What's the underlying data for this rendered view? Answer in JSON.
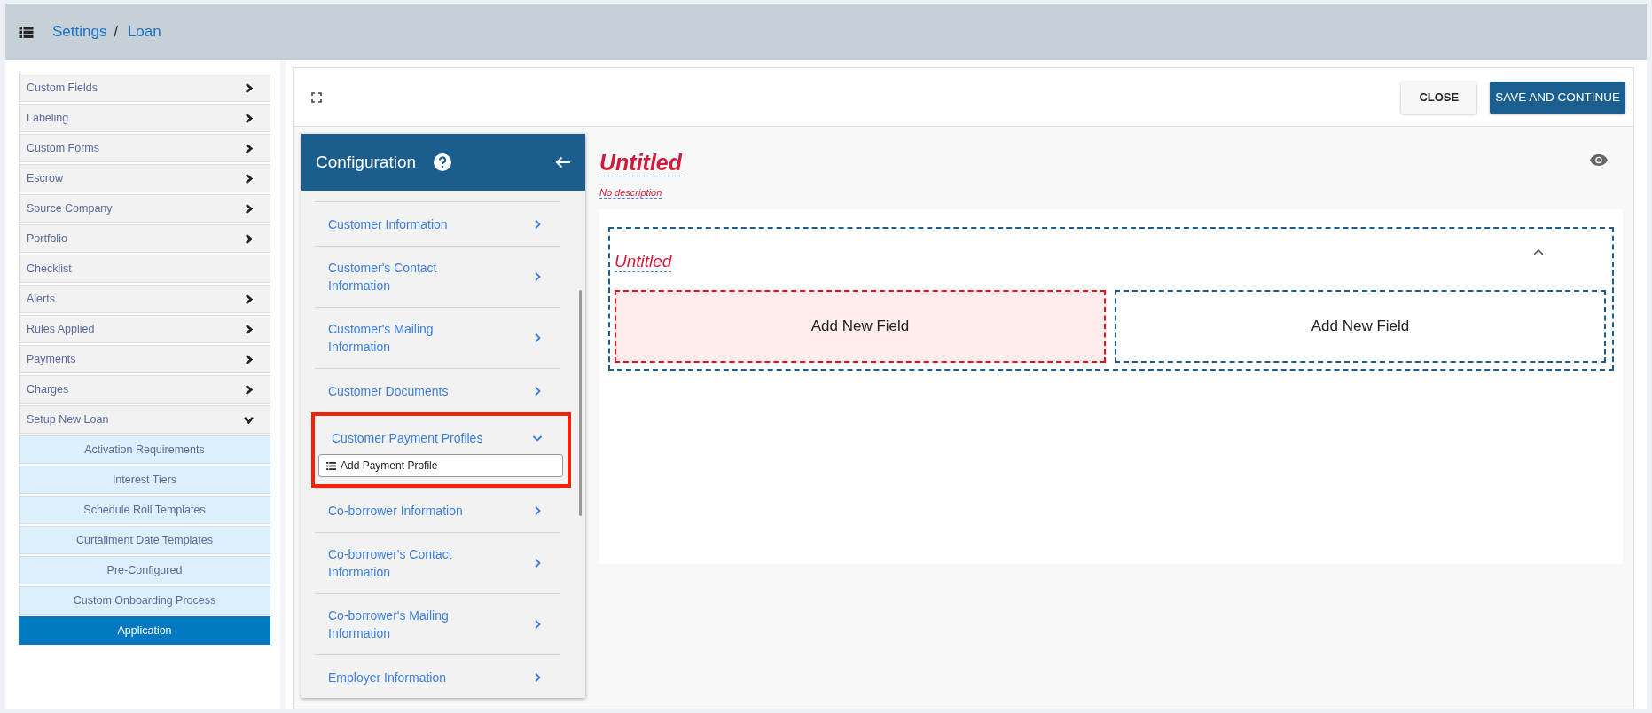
{
  "breadcrumb": [
    "Settings",
    "Loan"
  ],
  "breadcrumb_separator": "/",
  "sidebar": {
    "items": [
      {
        "label": "Custom Fields",
        "kind": "menu",
        "expanded": false
      },
      {
        "label": "Labeling",
        "kind": "menu",
        "expanded": false
      },
      {
        "label": "Custom Forms",
        "kind": "menu",
        "expanded": false
      },
      {
        "label": "Escrow",
        "kind": "menu",
        "expanded": false
      },
      {
        "label": "Source Company",
        "kind": "menu",
        "expanded": false
      },
      {
        "label": "Portfolio",
        "kind": "menu",
        "expanded": false
      },
      {
        "label": "Checklist",
        "kind": "plain"
      },
      {
        "label": "Alerts",
        "kind": "menu",
        "expanded": false
      },
      {
        "label": "Rules Applied",
        "kind": "menu",
        "expanded": false
      },
      {
        "label": "Payments",
        "kind": "menu",
        "expanded": false
      },
      {
        "label": "Charges",
        "kind": "menu",
        "expanded": false
      },
      {
        "label": "Setup New Loan",
        "kind": "menu",
        "expanded": true,
        "children": [
          {
            "label": "Activation Requirements",
            "selected": false
          },
          {
            "label": "Interest Tiers",
            "selected": false
          },
          {
            "label": "Schedule Roll Templates",
            "selected": false
          },
          {
            "label": "Curtailment Date Templates",
            "selected": false
          },
          {
            "label": "Pre-Configured",
            "selected": false
          },
          {
            "label": "Custom Onboarding Process",
            "selected": false
          },
          {
            "label": "Application",
            "selected": true
          }
        ]
      }
    ]
  },
  "toolbar": {
    "buttons": [
      {
        "label": "CLOSE",
        "kind": "secondary"
      },
      {
        "label": "SAVE AND CONTINUE",
        "kind": "primary"
      }
    ]
  },
  "configuration": {
    "title": "Configuration",
    "items": [
      {
        "label": "Customer Information",
        "expanded": false
      },
      {
        "label": "Customer's Contact Information",
        "expanded": false
      },
      {
        "label": "Customer's Mailing Information",
        "expanded": false
      },
      {
        "label": "Customer Documents",
        "expanded": false
      },
      {
        "label": "Customer Payment Profiles",
        "expanded": true,
        "highlighted": true,
        "action": "Add Payment Profile"
      },
      {
        "label": "Co-borrower Information",
        "expanded": false
      },
      {
        "label": "Co-borrower's Contact Information",
        "expanded": false
      },
      {
        "label": "Co-borrower's Mailing Information",
        "expanded": false
      },
      {
        "label": "Employer Information",
        "expanded": false
      }
    ]
  },
  "form": {
    "title": "Untitled",
    "description": "No description",
    "sections": [
      {
        "title": "Untitled",
        "expanded": true,
        "fields": [
          {
            "label": "Add New Field",
            "selected": true
          },
          {
            "label": "Add New Field",
            "selected": false
          }
        ]
      }
    ]
  }
}
